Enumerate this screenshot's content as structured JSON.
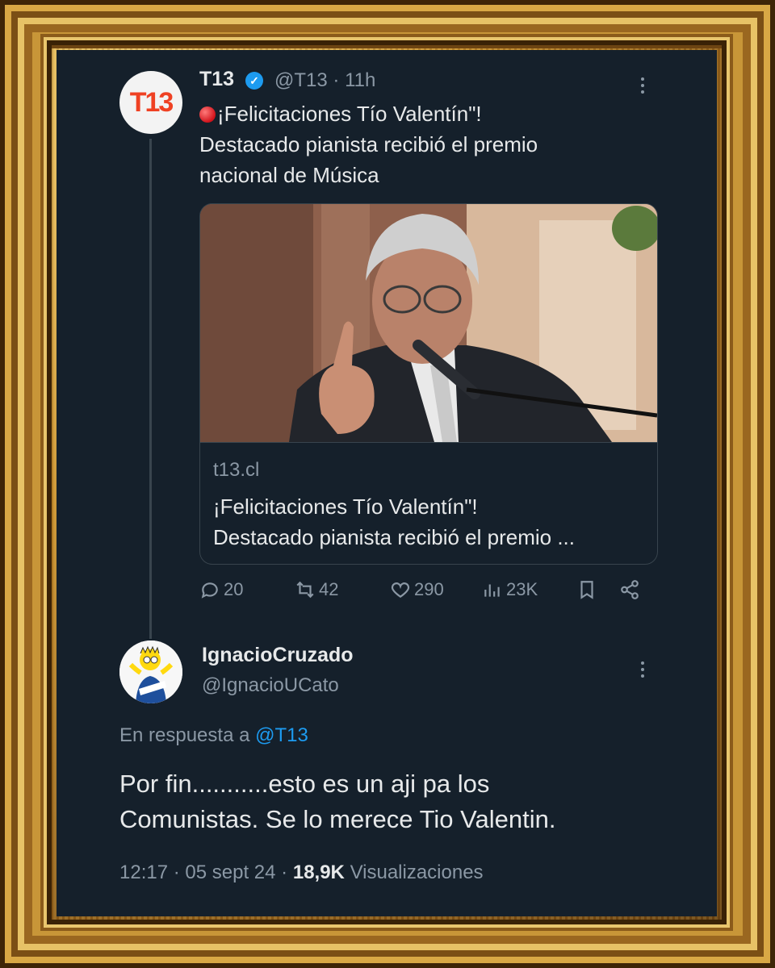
{
  "tweet": {
    "author_name": "T13",
    "avatar_text": "T13",
    "handle": "@T13",
    "separator": "·",
    "time": "11h",
    "text_line1": "¡Felicitaciones Tío Valentín\"!",
    "text_line2": "Destacado pianista recibió el premio",
    "text_line3": "nacional de Música",
    "card": {
      "domain": "t13.cl",
      "title_line1": "¡Felicitaciones Tío Valentín\"!",
      "title_line2": "Destacado pianista recibió el premio ..."
    },
    "stats": {
      "replies": "20",
      "retweets": "42",
      "likes": "290",
      "views": "23K"
    }
  },
  "reply": {
    "author_name": "IgnacioCruzado",
    "handle": "@IgnacioUCato",
    "reply_prefix": "En respuesta a",
    "reply_to": "@T13",
    "text_line1": "Por fin...........esto es un aji pa los",
    "text_line2": "Comunistas. Se lo merece Tio Valentin.",
    "time": "12:17",
    "sep1": "·",
    "date": "05 sept 24",
    "sep2": "·",
    "views_count": "18,9K",
    "views_label": "Visualizaciones"
  },
  "colors": {
    "background": "#15202b",
    "text": "#e7e9ea",
    "muted": "#8b98a5",
    "accent": "#1d9bf0",
    "border": "#38444d",
    "brand_t13": "#ef4123",
    "frame_gold": "#c88f2c"
  },
  "icons": [
    "verified-badge-icon",
    "more-icon",
    "reply-icon",
    "retweet-icon",
    "like-icon",
    "views-icon",
    "bookmark-icon",
    "share-icon",
    "red-circle-icon"
  ]
}
